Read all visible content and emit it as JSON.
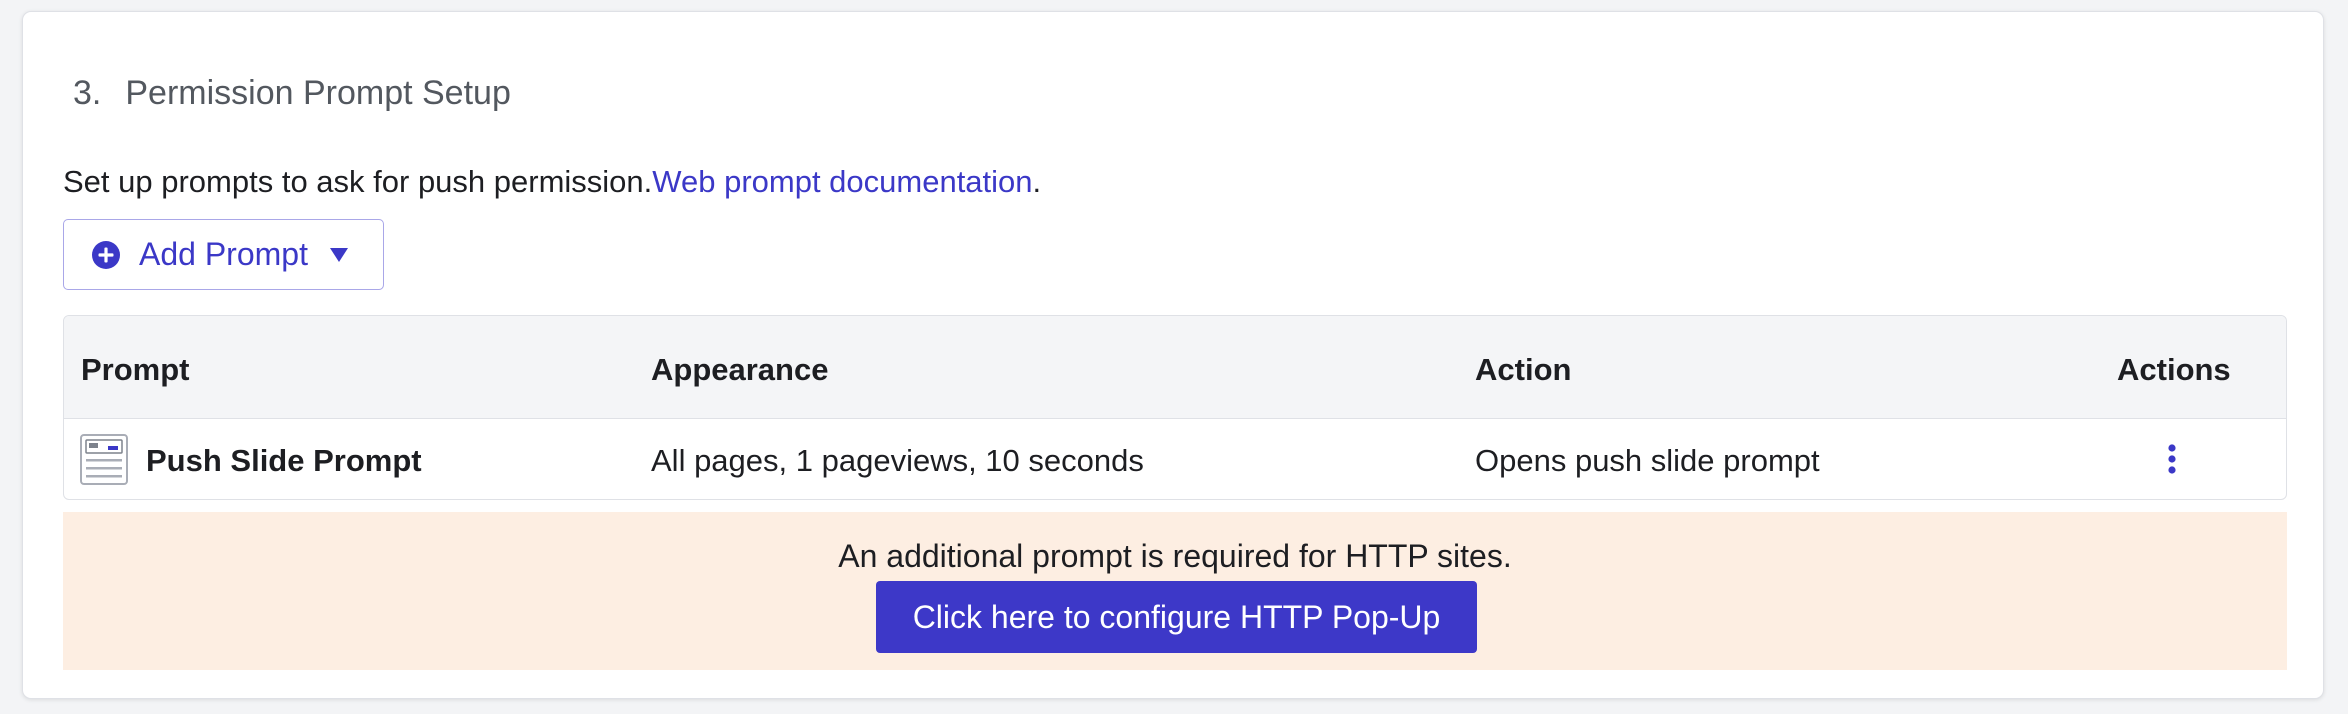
{
  "section": {
    "number": "3.",
    "title": "Permission Prompt Setup"
  },
  "intro": {
    "text": "Set up prompts to ask for push permission.",
    "link_text": "Web prompt documentation",
    "suffix": "."
  },
  "add_prompt": {
    "label": "Add Prompt",
    "icon": "plus-circle-icon",
    "dropdown_icon": "caret-down-icon"
  },
  "table": {
    "headers": {
      "prompt": "Prompt",
      "appearance": "Appearance",
      "action": "Action",
      "actions": "Actions"
    },
    "rows": [
      {
        "icon": "slide-prompt-icon",
        "prompt": "Push Slide Prompt",
        "appearance": "All pages, 1 pageviews, 10 seconds",
        "action": "Opens push slide prompt",
        "actions_icon": "kebab-menu-icon"
      }
    ]
  },
  "http_notice": {
    "text": "An additional prompt is required for HTTP sites.",
    "button_label": "Click here to configure HTTP Pop-Up"
  },
  "colors": {
    "accent": "#3d38c8",
    "link": "#3b38c7",
    "notice_bg": "#fdeee2",
    "header_bg": "#f4f5f7"
  }
}
